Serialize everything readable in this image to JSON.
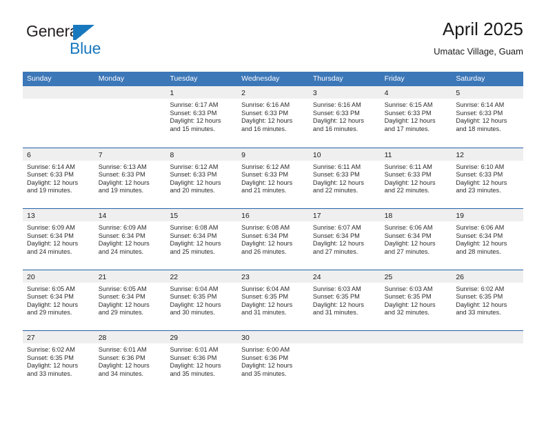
{
  "brand": {
    "name_top": "General",
    "name_bottom": "Blue",
    "flag_icon": "blue-flag-icon",
    "color_primary": "#1878be"
  },
  "header": {
    "title": "April 2025",
    "subtitle": "Umatac Village, Guam"
  },
  "theme": {
    "header_blue": "#3c77b8",
    "divider_blue": "#1f5fa8",
    "day_band_gray": "#efefef",
    "text": "#1a1a1a"
  },
  "calendar": {
    "weekdays": [
      "Sunday",
      "Monday",
      "Tuesday",
      "Wednesday",
      "Thursday",
      "Friday",
      "Saturday"
    ],
    "weeks": [
      [
        {
          "day": "",
          "lines": []
        },
        {
          "day": "",
          "lines": []
        },
        {
          "day": "1",
          "lines": [
            "Sunrise: 6:17 AM",
            "Sunset: 6:33 PM",
            "Daylight: 12 hours",
            "and 15 minutes."
          ]
        },
        {
          "day": "2",
          "lines": [
            "Sunrise: 6:16 AM",
            "Sunset: 6:33 PM",
            "Daylight: 12 hours",
            "and 16 minutes."
          ]
        },
        {
          "day": "3",
          "lines": [
            "Sunrise: 6:16 AM",
            "Sunset: 6:33 PM",
            "Daylight: 12 hours",
            "and 16 minutes."
          ]
        },
        {
          "day": "4",
          "lines": [
            "Sunrise: 6:15 AM",
            "Sunset: 6:33 PM",
            "Daylight: 12 hours",
            "and 17 minutes."
          ]
        },
        {
          "day": "5",
          "lines": [
            "Sunrise: 6:14 AM",
            "Sunset: 6:33 PM",
            "Daylight: 12 hours",
            "and 18 minutes."
          ]
        }
      ],
      [
        {
          "day": "6",
          "lines": [
            "Sunrise: 6:14 AM",
            "Sunset: 6:33 PM",
            "Daylight: 12 hours",
            "and 19 minutes."
          ]
        },
        {
          "day": "7",
          "lines": [
            "Sunrise: 6:13 AM",
            "Sunset: 6:33 PM",
            "Daylight: 12 hours",
            "and 19 minutes."
          ]
        },
        {
          "day": "8",
          "lines": [
            "Sunrise: 6:12 AM",
            "Sunset: 6:33 PM",
            "Daylight: 12 hours",
            "and 20 minutes."
          ]
        },
        {
          "day": "9",
          "lines": [
            "Sunrise: 6:12 AM",
            "Sunset: 6:33 PM",
            "Daylight: 12 hours",
            "and 21 minutes."
          ]
        },
        {
          "day": "10",
          "lines": [
            "Sunrise: 6:11 AM",
            "Sunset: 6:33 PM",
            "Daylight: 12 hours",
            "and 22 minutes."
          ]
        },
        {
          "day": "11",
          "lines": [
            "Sunrise: 6:11 AM",
            "Sunset: 6:33 PM",
            "Daylight: 12 hours",
            "and 22 minutes."
          ]
        },
        {
          "day": "12",
          "lines": [
            "Sunrise: 6:10 AM",
            "Sunset: 6:33 PM",
            "Daylight: 12 hours",
            "and 23 minutes."
          ]
        }
      ],
      [
        {
          "day": "13",
          "lines": [
            "Sunrise: 6:09 AM",
            "Sunset: 6:34 PM",
            "Daylight: 12 hours",
            "and 24 minutes."
          ]
        },
        {
          "day": "14",
          "lines": [
            "Sunrise: 6:09 AM",
            "Sunset: 6:34 PM",
            "Daylight: 12 hours",
            "and 24 minutes."
          ]
        },
        {
          "day": "15",
          "lines": [
            "Sunrise: 6:08 AM",
            "Sunset: 6:34 PM",
            "Daylight: 12 hours",
            "and 25 minutes."
          ]
        },
        {
          "day": "16",
          "lines": [
            "Sunrise: 6:08 AM",
            "Sunset: 6:34 PM",
            "Daylight: 12 hours",
            "and 26 minutes."
          ]
        },
        {
          "day": "17",
          "lines": [
            "Sunrise: 6:07 AM",
            "Sunset: 6:34 PM",
            "Daylight: 12 hours",
            "and 27 minutes."
          ]
        },
        {
          "day": "18",
          "lines": [
            "Sunrise: 6:06 AM",
            "Sunset: 6:34 PM",
            "Daylight: 12 hours",
            "and 27 minutes."
          ]
        },
        {
          "day": "19",
          "lines": [
            "Sunrise: 6:06 AM",
            "Sunset: 6:34 PM",
            "Daylight: 12 hours",
            "and 28 minutes."
          ]
        }
      ],
      [
        {
          "day": "20",
          "lines": [
            "Sunrise: 6:05 AM",
            "Sunset: 6:34 PM",
            "Daylight: 12 hours",
            "and 29 minutes."
          ]
        },
        {
          "day": "21",
          "lines": [
            "Sunrise: 6:05 AM",
            "Sunset: 6:34 PM",
            "Daylight: 12 hours",
            "and 29 minutes."
          ]
        },
        {
          "day": "22",
          "lines": [
            "Sunrise: 6:04 AM",
            "Sunset: 6:35 PM",
            "Daylight: 12 hours",
            "and 30 minutes."
          ]
        },
        {
          "day": "23",
          "lines": [
            "Sunrise: 6:04 AM",
            "Sunset: 6:35 PM",
            "Daylight: 12 hours",
            "and 31 minutes."
          ]
        },
        {
          "day": "24",
          "lines": [
            "Sunrise: 6:03 AM",
            "Sunset: 6:35 PM",
            "Daylight: 12 hours",
            "and 31 minutes."
          ]
        },
        {
          "day": "25",
          "lines": [
            "Sunrise: 6:03 AM",
            "Sunset: 6:35 PM",
            "Daylight: 12 hours",
            "and 32 minutes."
          ]
        },
        {
          "day": "26",
          "lines": [
            "Sunrise: 6:02 AM",
            "Sunset: 6:35 PM",
            "Daylight: 12 hours",
            "and 33 minutes."
          ]
        }
      ],
      [
        {
          "day": "27",
          "lines": [
            "Sunrise: 6:02 AM",
            "Sunset: 6:35 PM",
            "Daylight: 12 hours",
            "and 33 minutes."
          ]
        },
        {
          "day": "28",
          "lines": [
            "Sunrise: 6:01 AM",
            "Sunset: 6:36 PM",
            "Daylight: 12 hours",
            "and 34 minutes."
          ]
        },
        {
          "day": "29",
          "lines": [
            "Sunrise: 6:01 AM",
            "Sunset: 6:36 PM",
            "Daylight: 12 hours",
            "and 35 minutes."
          ]
        },
        {
          "day": "30",
          "lines": [
            "Sunrise: 6:00 AM",
            "Sunset: 6:36 PM",
            "Daylight: 12 hours",
            "and 35 minutes."
          ]
        },
        {
          "day": "",
          "lines": []
        },
        {
          "day": "",
          "lines": []
        },
        {
          "day": "",
          "lines": []
        }
      ]
    ]
  }
}
